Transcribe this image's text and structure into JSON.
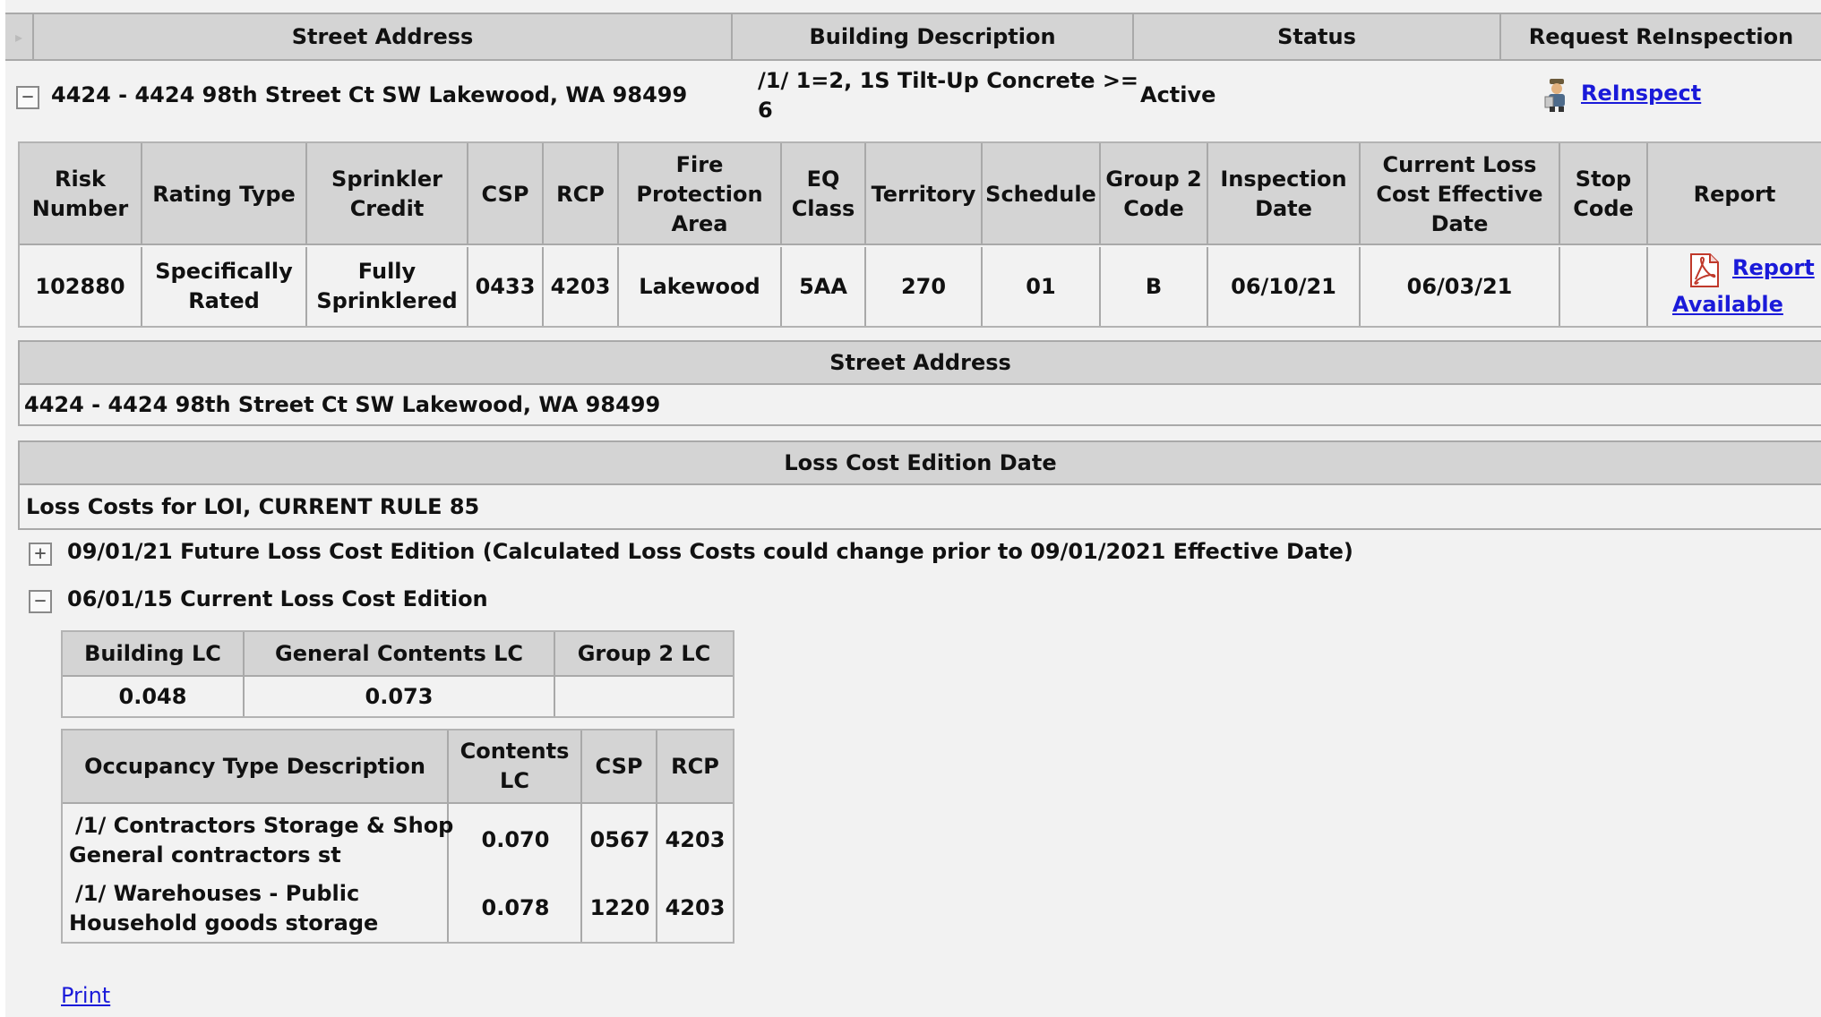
{
  "top_header": {
    "columns": [
      "Street Address",
      "Building Description",
      "Status",
      "Request ReInspection"
    ]
  },
  "building": {
    "toggle": "−",
    "address": "4424 - 4424 98th Street Ct SW Lakewood, WA 98499",
    "description_line1": "/1/ 1=2, 1S Tilt-Up Concrete >=",
    "description_line2": "6",
    "status": "Active",
    "reinspect_label": "ReInspect",
    "reinspect_icon": "inspector-person-icon"
  },
  "risk_table": {
    "headers": [
      [
        "Risk",
        "Number"
      ],
      [
        "Rating Type"
      ],
      [
        "Sprinkler",
        "Credit"
      ],
      [
        "CSP"
      ],
      [
        "RCP"
      ],
      [
        "Fire",
        "Protection",
        "Area"
      ],
      [
        "EQ",
        "Class"
      ],
      [
        "Territory"
      ],
      [
        "Schedule"
      ],
      [
        "Group 2",
        "Code"
      ],
      [
        "Inspection",
        "Date"
      ],
      [
        "Current Loss",
        "Cost Effective",
        "Date"
      ],
      [
        "Stop",
        "Code"
      ],
      [
        "Report"
      ]
    ],
    "row": [
      [
        "102880"
      ],
      [
        "Specifically",
        "Rated"
      ],
      [
        "Fully",
        "Sprinklered"
      ],
      [
        "0433"
      ],
      [
        "4203"
      ],
      [
        "Lakewood"
      ],
      [
        "5AA"
      ],
      [
        "270"
      ],
      [
        "01"
      ],
      [
        "B"
      ],
      [
        "06/10/21"
      ],
      [
        "06/03/21"
      ],
      [
        ""
      ]
    ],
    "report_link_line1": "Report",
    "report_link_line2": "Available",
    "report_icon": "pdf-file-icon"
  },
  "street_section": {
    "header": "Street Address",
    "value": "4424 - 4424 98th Street Ct SW Lakewood, WA 98499"
  },
  "loss_cost_section": {
    "header": "Loss Cost Edition Date",
    "subtitle": "Loss Costs for LOI, CURRENT RULE 85",
    "future_toggle": "+",
    "future_edition": "09/01/21 Future Loss Cost Edition (Calculated Loss Costs could change prior to 09/01/2021 Effective Date)",
    "current_toggle": "−",
    "current_edition": "06/01/15 Current Loss Cost Edition"
  },
  "lc_table": {
    "headers": [
      "Building LC",
      "General Contents LC",
      "Group 2 LC"
    ],
    "row": [
      "0.048",
      "0.073",
      ""
    ]
  },
  "occupancy_table": {
    "headers": [
      [
        "Occupancy Type Description"
      ],
      [
        "Contents",
        "LC"
      ],
      [
        "CSP"
      ],
      [
        "RCP"
      ]
    ],
    "rows": [
      {
        "desc_line1": "/1/ Contractors Storage & Shop",
        "desc_line2": "General contractors st",
        "contents_lc": "0.070",
        "csp": "0567",
        "rcp": "4203"
      },
      {
        "desc_line1": "/1/ Warehouses - Public",
        "desc_line2": "Household goods storage",
        "contents_lc": "0.078",
        "csp": "1220",
        "rcp": "4203"
      }
    ]
  },
  "print_label": "Print"
}
